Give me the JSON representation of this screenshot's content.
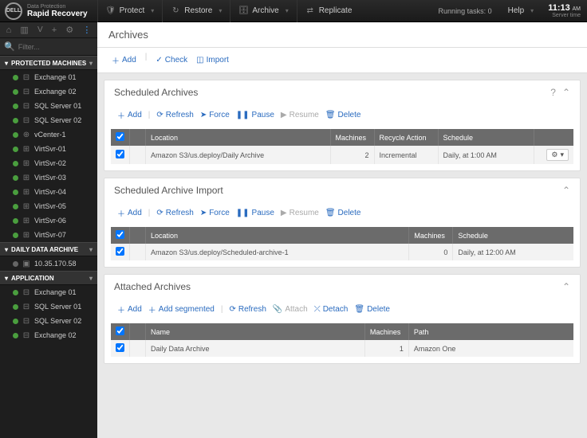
{
  "brand": {
    "small": "Data Protection",
    "large": "Rapid Recovery"
  },
  "topbar": {
    "protect": "Protect",
    "restore": "Restore",
    "archive": "Archive",
    "replicate": "Replicate",
    "running_tasks": "Running tasks: 0",
    "help": "Help",
    "time": "11:13",
    "time_suffix": "AM",
    "time_sub": "Server time"
  },
  "search": {
    "placeholder": "Filter..."
  },
  "sidebar": {
    "sections": [
      {
        "title": "PROTECTED MACHINES",
        "items": [
          {
            "label": "Exchange 01",
            "status": "green",
            "icon": "db"
          },
          {
            "label": "Exchange 02",
            "status": "green",
            "icon": "db"
          },
          {
            "label": "SQL Server 01",
            "status": "green",
            "icon": "db"
          },
          {
            "label": "SQL Server 02",
            "status": "green",
            "icon": "db"
          },
          {
            "label": "vCenter-1",
            "status": "green",
            "icon": "vc"
          },
          {
            "label": "VirtSvr-01",
            "status": "green",
            "icon": "vm"
          },
          {
            "label": "VirtSvr-02",
            "status": "green",
            "icon": "vm"
          },
          {
            "label": "VirtSvr-03",
            "status": "green",
            "icon": "vm"
          },
          {
            "label": "VirtSvr-04",
            "status": "green",
            "icon": "vm"
          },
          {
            "label": "VirtSvr-05",
            "status": "green",
            "icon": "vm"
          },
          {
            "label": "VirtSvr-06",
            "status": "green",
            "icon": "vm"
          },
          {
            "label": "VirtSvr-07",
            "status": "green",
            "icon": "vm"
          }
        ]
      },
      {
        "title": "DAILY DATA ARCHIVE",
        "items": [
          {
            "label": "10.35.170.58",
            "status": "gray",
            "icon": "srv"
          }
        ]
      },
      {
        "title": "APPLICATION",
        "items": [
          {
            "label": "Exchange 01",
            "status": "green",
            "icon": "db"
          },
          {
            "label": "SQL Server 01",
            "status": "green",
            "icon": "db"
          },
          {
            "label": "SQL Server 02",
            "status": "green",
            "icon": "db"
          },
          {
            "label": "Exchange 02",
            "status": "green",
            "icon": "db"
          }
        ]
      }
    ]
  },
  "page": {
    "title": "Archives"
  },
  "actions": {
    "add": "Add",
    "check": "Check",
    "import": "Import",
    "refresh": "Refresh",
    "force": "Force",
    "pause": "Pause",
    "resume": "Resume",
    "delete": "Delete",
    "add_segmented": "Add segmented",
    "attach": "Attach",
    "detach": "Detach"
  },
  "panels": {
    "scheduled": {
      "title": "Scheduled Archives",
      "cols": {
        "location": "Location",
        "machines": "Machines",
        "recycle": "Recycle Action",
        "schedule": "Schedule"
      },
      "rows": [
        {
          "location": "Amazon S3/us.deploy/Daily Archive",
          "machines": "2",
          "recycle": "Incremental",
          "schedule": "Daily, at 1:00 AM"
        }
      ]
    },
    "import": {
      "title": "Scheduled Archive Import",
      "cols": {
        "location": "Location",
        "machines": "Machines",
        "schedule": "Schedule"
      },
      "rows": [
        {
          "location": "Amazon S3/us.deploy/Scheduled-archive-1",
          "machines": "0",
          "schedule": "Daily, at 12:00 AM"
        }
      ]
    },
    "attached": {
      "title": "Attached Archives",
      "cols": {
        "name": "Name",
        "machines": "Machines",
        "path": "Path"
      },
      "rows": [
        {
          "name": "Daily Data Archive",
          "machines": "1",
          "path": "Amazon One"
        }
      ]
    }
  }
}
